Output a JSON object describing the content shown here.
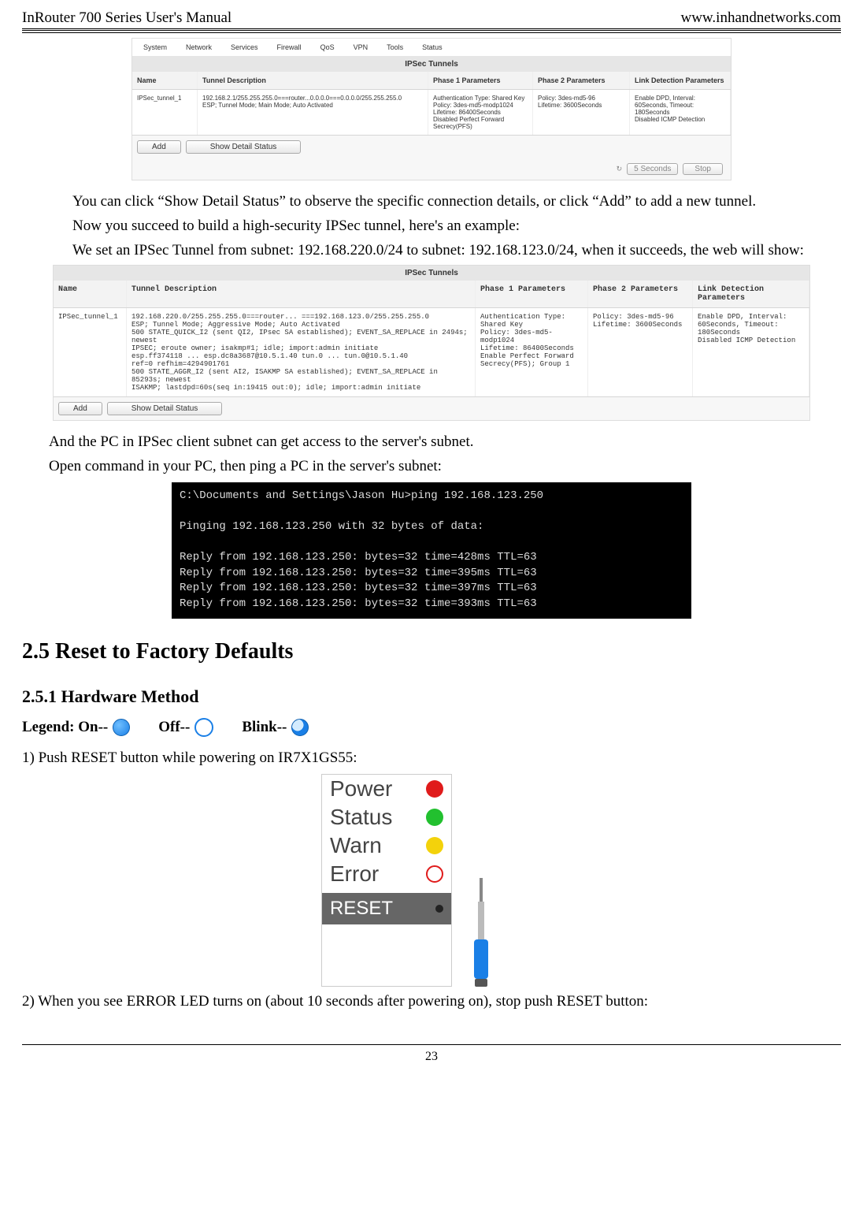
{
  "header": {
    "left": "InRouter 700 Series User's Manual",
    "right": "www.inhandnetworks.com"
  },
  "screenshot1": {
    "tabs": [
      "System",
      "Network",
      "Services",
      "Firewall",
      "QoS",
      "VPN",
      "Tools",
      "Status"
    ],
    "title": "IPSec Tunnels",
    "cols": [
      "Name",
      "Tunnel Description",
      "Phase 1 Parameters",
      "Phase 2 Parameters",
      "Link Detection Parameters"
    ],
    "row": {
      "name": "IPSec_tunnel_1",
      "desc": "192.168.2.1/255.255.255.0===router...0.0.0.0===0.0.0.0/255.255.255.0\nESP; Tunnel Mode; Main Mode; Auto Activated",
      "p1": "Authentication Type: Shared Key\nPolicy: 3des-md5-modp1024\nLifetime: 86400Seconds\nDisabled Perfect Forward Secrecy(PFS)",
      "p2": "Policy: 3des-md5-96\nLifetime: 3600Seconds",
      "ld": "Enable DPD, Interval: 60Seconds, Timeout: 180Seconds\nDisabled ICMP Detection"
    },
    "buttons": {
      "add": "Add",
      "detail": "Show Detail Status"
    },
    "refresh": {
      "interval": "5 Seconds",
      "stop": "Stop"
    }
  },
  "para1": "You can click “Show Detail Status” to observe the specific connection details, or click “Add” to add a new tunnel.",
  "para2": "Now you succeed to build a high-security IPSec tunnel, here's an example:",
  "para3": "We set an IPSec Tunnel from subnet: 192.168.220.0/24 to subnet: 192.168.123.0/24, when it succeeds, the web will show:",
  "screenshot2": {
    "title": "IPSec Tunnels",
    "cols": [
      "Name",
      "Tunnel Description",
      "Phase 1 Parameters",
      "Phase 2 Parameters",
      "Link Detection Parameters"
    ],
    "row": {
      "name": "IPSec_tunnel_1",
      "desc": "192.168.220.0/255.255.255.0===router... ===192.168.123.0/255.255.255.0\nESP; Tunnel Mode; Aggressive Mode; Auto Activated\n500 STATE_QUICK_I2 (sent QI2, IPsec SA established); EVENT_SA_REPLACE in 2494s; newest\nIPSEC; eroute owner; isakmp#1; idle; import:admin initiate\nesp.ff374118 ... esp.dc8a3687@10.5.1.40 tun.0 ... tun.0@10.5.1.40\nref=0 refhim=4294901761\n500 STATE_AGGR_I2 (sent AI2, ISAKMP SA established); EVENT_SA_REPLACE in 85293s; newest\nISAKMP; lastdpd=60s(seq in:19415 out:0); idle; import:admin initiate",
      "p1": "Authentication Type: Shared Key\nPolicy: 3des-md5-modp1024\nLifetime: 86400Seconds\nEnable Perfect Forward Secrecy(PFS); Group 1",
      "p2": "Policy: 3des-md5-96\nLifetime: 3600Seconds",
      "ld": "Enable DPD, Interval: 60Seconds, Timeout: 180Seconds\nDisabled ICMP Detection"
    },
    "buttons": {
      "add": "Add",
      "detail": "Show Detail Status"
    }
  },
  "para4": "And the PC in IPSec client subnet can get access to the server's subnet.",
  "para5": "Open command in your PC, then ping a PC in the server's subnet:",
  "cmd": {
    "l1": "C:\\Documents and Settings\\Jason Hu>ping 192.168.123.250",
    "l2": "Pinging 192.168.123.250 with 32 bytes of data:",
    "l3": "Reply from 192.168.123.250: bytes=32 time=428ms TTL=63",
    "l4": "Reply from 192.168.123.250: bytes=32 time=395ms TTL=63",
    "l5": "Reply from 192.168.123.250: bytes=32 time=397ms TTL=63",
    "l6": "Reply from 192.168.123.250: bytes=32 time=393ms TTL=63"
  },
  "h2": "2.5 Reset to Factory Defaults",
  "h3": "2.5.1    Hardware Method",
  "legend": {
    "prefix": "Legend: On--",
    "off": "Off--",
    "blink": "Blink--"
  },
  "step1": "1) Push RESET button while powering on IR7X1GS55:",
  "panel": {
    "power": "Power",
    "status": "Status",
    "warn": "Warn",
    "error": "Error",
    "reset": "RESET"
  },
  "step2": "2) When you see ERROR LED turns on (about 10 seconds after powering on), stop push RESET button:",
  "footer": "23"
}
